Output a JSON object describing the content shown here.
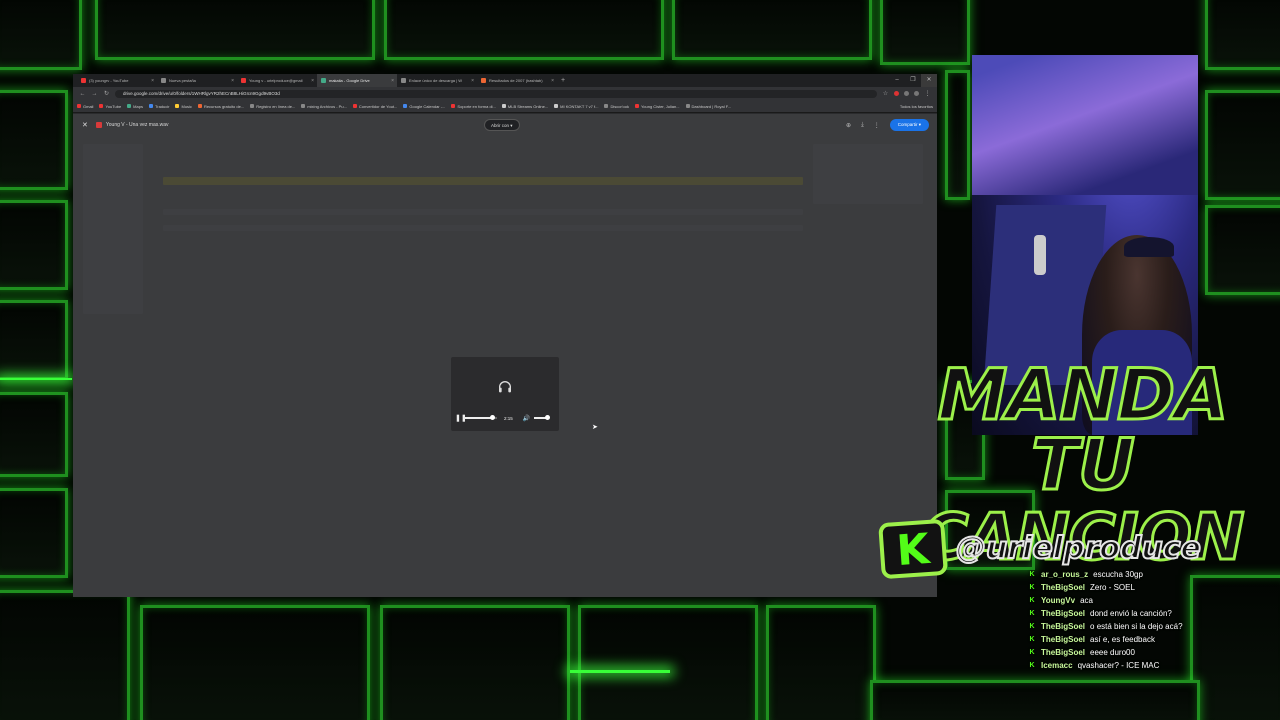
{
  "browser": {
    "tabs": [
      {
        "label": "(3) youngrv - YouTube",
        "color": "#e33"
      },
      {
        "label": "Nueva pestaña",
        "color": "#888"
      },
      {
        "label": "Young v - urielproduce@gmail",
        "color": "#e33"
      },
      {
        "label": "makaiia - Google Drive",
        "color": "#4a8"
      },
      {
        "label": "Enlace único de descarga | W",
        "color": "#888"
      },
      {
        "label": "Resultados de 2007 (hashtab)",
        "color": "#e63"
      }
    ],
    "new_tab": "+",
    "url": "drive.google.com/drive/u/0/folders/1WHRlgvYR2hECnB8LHiGIcn9Ggd9vBO3d",
    "bookmarks": [
      {
        "label": "Gmail",
        "color": "#e33"
      },
      {
        "label": "YouTube",
        "color": "#e33"
      },
      {
        "label": "Maps",
        "color": "#4a8"
      },
      {
        "label": "Traducir",
        "color": "#48e"
      },
      {
        "label": "Music",
        "color": "#fc3"
      },
      {
        "label": "Recursos gratuito de...",
        "color": "#e63"
      },
      {
        "label": "Registro en línea de...",
        "color": "#888"
      },
      {
        "label": "mixing Archivos - Pu...",
        "color": "#888"
      },
      {
        "label": "Convertidor de Yout...",
        "color": "#e33"
      },
      {
        "label": "Google Calendar -...",
        "color": "#48e"
      },
      {
        "label": "Soporte en forma di...",
        "color": "#e33"
      },
      {
        "label": "MLB Streams Online...",
        "color": "#ccc"
      },
      {
        "label": "MI KONTAKT 7 v7 f...",
        "color": "#ccc"
      },
      {
        "label": "Discor'ook",
        "color": "#888"
      },
      {
        "label": "Young Cister, Julian...",
        "color": "#e33"
      },
      {
        "label": "Dashboard | Royal F...",
        "color": "#888"
      }
    ],
    "bookmarks_all": "Todos los favoritos"
  },
  "viewer": {
    "file_name": "Young V - Una vez mas.wav",
    "open_with": "Abrir con",
    "share": "Compartir",
    "time": "2:15",
    "progress": 0.85
  },
  "overlay": {
    "title_line1": "MANDA TU",
    "title_line2": "CANCION",
    "kick_letter": "K",
    "handle": "@urielproduce"
  },
  "chat": [
    {
      "user": "ar_o_rous_z",
      "text": "escucha 30gp"
    },
    {
      "user": "TheBigSoel",
      "text": "Zero - SOEL"
    },
    {
      "user": "YoungVv",
      "text": "aca"
    },
    {
      "user": "TheBigSoel",
      "text": "dond envió la canción?"
    },
    {
      "user": "TheBigSoel",
      "text": "o está bien si la dejo acá?"
    },
    {
      "user": "TheBigSoel",
      "text": "así e, es feedback"
    },
    {
      "user": "TheBigSoel",
      "text": "eeee duro00"
    },
    {
      "user": "Icemacc",
      "text": "qvashacer? - ICE MAC"
    }
  ],
  "colors": {
    "neon": "#38ff38",
    "kick": "#53fc18",
    "share": "#1a73e8"
  }
}
